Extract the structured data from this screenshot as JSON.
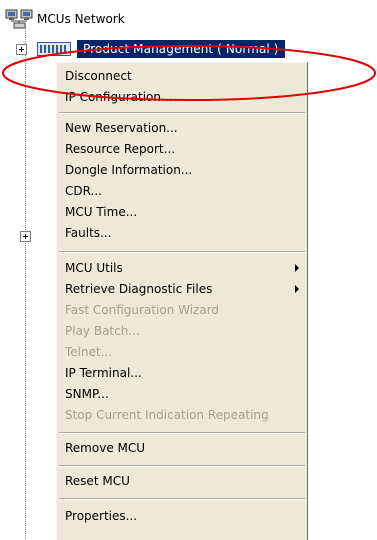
{
  "tree": {
    "root_label": "MCUs Network",
    "root_icon": "network-icon",
    "node_label": "Product Management   ( Normal )",
    "node_icon": "mcu-device-icon",
    "selection_color": "#0a246a",
    "highlight_color": "#e00000"
  },
  "context_menu": {
    "items": [
      {
        "label": "Disconnect",
        "enabled": true
      },
      {
        "label": "IP Configuration...",
        "enabled": true
      },
      {
        "label": "New Reservation...",
        "enabled": true
      },
      {
        "label": "Resource Report...",
        "enabled": true
      },
      {
        "label": "Dongle Information...",
        "enabled": true
      },
      {
        "label": "CDR...",
        "enabled": true
      },
      {
        "label": "MCU Time...",
        "enabled": true
      },
      {
        "label": "Faults...",
        "enabled": true
      },
      {
        "label": "MCU Utils",
        "enabled": true,
        "submenu": true
      },
      {
        "label": "Retrieve Diagnostic Files",
        "enabled": true,
        "submenu": true
      },
      {
        "label": "Fast Configuration Wizard",
        "enabled": false
      },
      {
        "label": "Play Batch...",
        "enabled": false
      },
      {
        "label": "Telnet...",
        "enabled": false
      },
      {
        "label": "IP Terminal...",
        "enabled": true
      },
      {
        "label": "SNMP...",
        "enabled": true
      },
      {
        "label": "Stop Current Indication Repeating",
        "enabled": false
      },
      {
        "label": "Remove MCU",
        "enabled": true
      },
      {
        "label": "Reset MCU",
        "enabled": true
      },
      {
        "label": "Properties...",
        "enabled": true
      }
    ]
  }
}
